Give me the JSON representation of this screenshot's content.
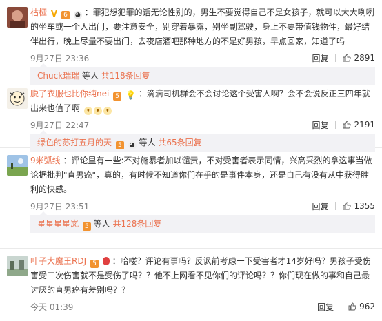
{
  "comments": [
    {
      "author": "枯桠",
      "text": "：罪犯想犯罪的话无论性别的，男生不要觉得自己不是女孩子，就可以大大咧咧的坐车或一个人出门，要注意安全，别穿着暴露，别坐副驾驶，身上不要带值钱物件，最好结伴出行，晚上尽量不要出门，去夜店酒吧那种地方的不是好男孩，早点回家，知道了吗",
      "time": "9月27日 23:36",
      "reply_label": "回复",
      "likes": "2891",
      "sub": {
        "who": "Chuck瑞瑞",
        "mid": " 等人 ",
        "total": "共118条回复"
      }
    },
    {
      "author": "脱了衣服也比你纯nei",
      "text": "：滴滴司机群会不会讨论这个受害人啊？会不会说反正三四年就出来也值了啊",
      "time": "9月27日 22:47",
      "reply_label": "回复",
      "likes": "2191",
      "sub": {
        "who": "绿色的苏打五月的天",
        "mid": " 等人 ",
        "total": "共65条回复"
      }
    },
    {
      "author": "9米弧线",
      "text": "：评论里有一些:不对施暴者加以谴责，不对受害者表示同情，兴高采烈的拿这事当做论据批判\"直男癌\"，真的，有时候不知道你们在乎的是事件本身，还是自己有没有从中获得胜利的快感。",
      "time": "9月27日 23:51",
      "reply_label": "回复",
      "likes": "1355",
      "sub": {
        "who": "星星星星岚",
        "mid": " 等人 ",
        "total": "共128条回复"
      }
    },
    {
      "author": "叶子大魔王RDJ",
      "text": "：哈喽？评论有事吗？反讽前考虑一下受害者才14岁好吗？男孩子受伤害受二次伤害就不是受伤了吗？？他不上网看不见你们的评论吗？？你们现在做的事和自己最讨厌的直男癌有差别吗？？",
      "time": "今天 01:39",
      "reply_label": "回复",
      "likes": "962"
    }
  ],
  "icons": {
    "like": "thumbs-up-icon",
    "badge_vip": "vip-badge-icon",
    "badge_v": "verified-v-icon"
  },
  "colors": {
    "username": "#eb7350",
    "meta": "#808080",
    "subbar_bg": "#f2f2f5"
  }
}
